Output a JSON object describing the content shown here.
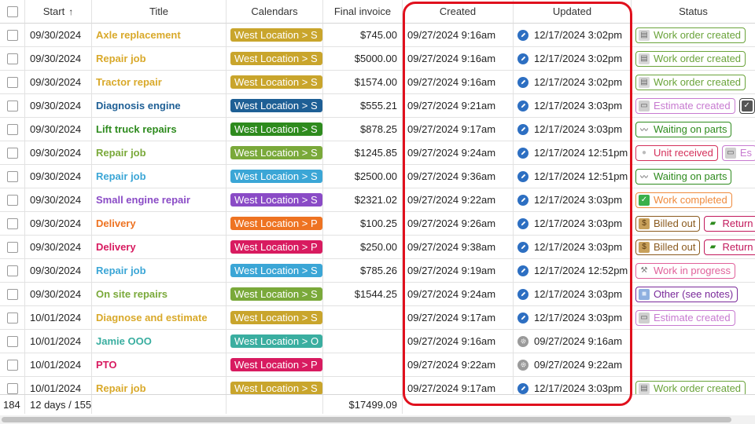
{
  "header": {
    "start": "Start",
    "sort_indicator": "↑",
    "title": "Title",
    "calendars": "Calendars",
    "final_invoice": "Final invoice",
    "created": "Created",
    "updated": "Updated",
    "status": "Status"
  },
  "rows": [
    {
      "start": "09/30/2024",
      "title": "Axle replacement",
      "title_color": "#d9a92a",
      "calendar": "West Location > S",
      "cal_color": "#c9a52c",
      "invoice": "$745.00",
      "created": "09/27/2024 9:16am",
      "updated": "12/17/2024 3:02pm",
      "updated_icon": "pencil-icon",
      "status": [
        {
          "label": "Work order created",
          "color": "#6aa33a",
          "icon": "document-icon"
        }
      ]
    },
    {
      "start": "09/30/2024",
      "title": "Repair job",
      "title_color": "#d9a92a",
      "calendar": "West Location > S",
      "cal_color": "#c9a52c",
      "invoice": "$5000.00",
      "created": "09/27/2024 9:16am",
      "updated": "12/17/2024 3:02pm",
      "updated_icon": "pencil-icon",
      "status": [
        {
          "label": "Work order created",
          "color": "#6aa33a",
          "icon": "document-icon"
        }
      ]
    },
    {
      "start": "09/30/2024",
      "title": "Tractor repair",
      "title_color": "#d9a92a",
      "calendar": "West Location > S",
      "cal_color": "#c9a52c",
      "invoice": "$1574.00",
      "created": "09/27/2024 9:16am",
      "updated": "12/17/2024 3:02pm",
      "updated_icon": "pencil-icon",
      "status": [
        {
          "label": "Work order created",
          "color": "#6aa33a",
          "icon": "document-icon"
        }
      ]
    },
    {
      "start": "09/30/2024",
      "title": "Diagnosis engine",
      "title_color": "#1e5f95",
      "calendar": "West Location > S",
      "cal_color": "#1e5f95",
      "invoice": "$555.21",
      "created": "09/27/2024 9:21am",
      "updated": "12/17/2024 3:03pm",
      "updated_icon": "pencil-icon",
      "status": [
        {
          "label": "Estimate created",
          "color": "#c77ad0",
          "icon": "printer-icon"
        },
        {
          "label": "",
          "color": "#444444",
          "icon": "checkbox-icon"
        }
      ]
    },
    {
      "start": "09/30/2024",
      "title": "Lift truck repairs",
      "title_color": "#2e8b1e",
      "calendar": "West Location > S",
      "cal_color": "#2e8b1e",
      "invoice": "$878.25",
      "created": "09/27/2024 9:17am",
      "updated": "12/17/2024 3:03pm",
      "updated_icon": "pencil-icon",
      "status": [
        {
          "label": "Waiting on parts",
          "color": "#2e8b1e",
          "icon": "wave-icon"
        }
      ]
    },
    {
      "start": "09/30/2024",
      "title": "Repair job",
      "title_color": "#7aa93a",
      "calendar": "West Location > S",
      "cal_color": "#7aa93a",
      "invoice": "$1245.85",
      "created": "09/27/2024 9:24am",
      "updated": "12/17/2024 12:51pm",
      "updated_icon": "pencil-icon",
      "status": [
        {
          "label": "Unit received",
          "color": "#d4305a",
          "icon": "globe-icon"
        },
        {
          "label": "Es",
          "color": "#c77ad0",
          "icon": "printer-icon"
        }
      ]
    },
    {
      "start": "09/30/2024",
      "title": "Repair job",
      "title_color": "#3ba6d6",
      "calendar": "West Location > S",
      "cal_color": "#3ba6d6",
      "invoice": "$2500.00",
      "created": "09/27/2024 9:36am",
      "updated": "12/17/2024 12:51pm",
      "updated_icon": "pencil-icon",
      "status": [
        {
          "label": "Waiting on parts",
          "color": "#2e8b1e",
          "icon": "wave-icon"
        }
      ]
    },
    {
      "start": "09/30/2024",
      "title": "Small engine repair",
      "title_color": "#8a4bc6",
      "calendar": "West Location > S",
      "cal_color": "#8a4bc6",
      "invoice": "$2321.02",
      "created": "09/27/2024 9:22am",
      "updated": "12/17/2024 3:03pm",
      "updated_icon": "pencil-icon",
      "status": [
        {
          "label": "Work completed",
          "color": "#ef8a3c",
          "icon": "check-icon"
        }
      ]
    },
    {
      "start": "09/30/2024",
      "title": "Delivery",
      "title_color": "#ee7322",
      "calendar": "West Location > P",
      "cal_color": "#ee7322",
      "invoice": "$100.25",
      "created": "09/27/2024 9:26am",
      "updated": "12/17/2024 3:03pm",
      "updated_icon": "pencil-icon",
      "status": [
        {
          "label": "Billed out",
          "color": "#8a5a1e",
          "icon": "moneybag-icon"
        },
        {
          "label": "Return",
          "color": "#c2185b",
          "icon": "truck-icon"
        }
      ]
    },
    {
      "start": "09/30/2024",
      "title": "Delivery",
      "title_color": "#d81b60",
      "calendar": "West Location > P",
      "cal_color": "#d81b60",
      "invoice": "$250.00",
      "created": "09/27/2024 9:38am",
      "updated": "12/17/2024 3:03pm",
      "updated_icon": "pencil-icon",
      "status": [
        {
          "label": "Billed out",
          "color": "#8a5a1e",
          "icon": "moneybag-icon"
        },
        {
          "label": "Return",
          "color": "#c2185b",
          "icon": "truck-icon"
        }
      ]
    },
    {
      "start": "09/30/2024",
      "title": "Repair job",
      "title_color": "#3ba6d6",
      "calendar": "West Location > S",
      "cal_color": "#3ba6d6",
      "invoice": "$785.26",
      "created": "09/27/2024 9:19am",
      "updated": "12/17/2024 12:52pm",
      "updated_icon": "pencil-icon",
      "status": [
        {
          "label": "Work in progress",
          "color": "#e0609a",
          "icon": "wrench-icon"
        }
      ]
    },
    {
      "start": "09/30/2024",
      "title": "On site repairs",
      "title_color": "#7aa93a",
      "calendar": "West Location > S",
      "cal_color": "#7aa93a",
      "invoice": "$1544.25",
      "created": "09/27/2024 9:24am",
      "updated": "12/17/2024 3:03pm",
      "updated_icon": "pencil-icon",
      "status": [
        {
          "label": "Other (see notes)",
          "color": "#7a2a9a",
          "icon": "square-icon"
        }
      ]
    },
    {
      "start": "10/01/2024",
      "title": "Diagnose and estimate",
      "title_color": "#d9a92a",
      "calendar": "West Location > S",
      "cal_color": "#c9a52c",
      "invoice": "",
      "created": "09/27/2024 9:17am",
      "updated": "12/17/2024 3:03pm",
      "updated_icon": "pencil-icon",
      "status": [
        {
          "label": "Estimate created",
          "color": "#c77ad0",
          "icon": "printer-icon"
        }
      ]
    },
    {
      "start": "10/01/2024",
      "title": "Jamie OOO",
      "title_color": "#3aaea0",
      "calendar": "West Location > O",
      "cal_color": "#3aaea0",
      "invoice": "",
      "created": "09/27/2024 9:16am",
      "updated": "09/27/2024 9:16am",
      "updated_icon": "gear-icon",
      "status": []
    },
    {
      "start": "10/01/2024",
      "title": "PTO",
      "title_color": "#d81b60",
      "calendar": "West Location > P",
      "cal_color": "#d81b60",
      "invoice": "",
      "created": "09/27/2024 9:22am",
      "updated": "09/27/2024 9:22am",
      "updated_icon": "gear-icon",
      "status": []
    },
    {
      "start": "10/01/2024",
      "title": "Repair job",
      "title_color": "#d9a92a",
      "calendar": "West Location > S",
      "cal_color": "#c9a52c",
      "invoice": "",
      "created": "09/27/2024 9:17am",
      "updated": "12/17/2024 3:03pm",
      "updated_icon": "pencil-icon",
      "status": [
        {
          "label": "Work order created",
          "color": "#6aa33a",
          "icon": "document-icon"
        }
      ]
    }
  ],
  "footer": {
    "count": "184",
    "duration": "12 days / 155",
    "invoice_total": "$17499.09"
  },
  "highlight_color": "#e0101d"
}
